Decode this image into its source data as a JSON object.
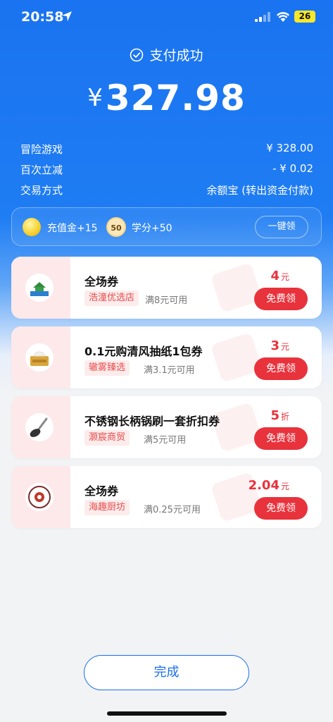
{
  "status_bar": {
    "time": "20:58",
    "battery": "26"
  },
  "header": {
    "status_text": "支付成功",
    "currency": "¥",
    "amount": "327.98"
  },
  "details": [
    {
      "label": "冒险游戏",
      "value": "¥ 328.00"
    },
    {
      "label": "百次立减",
      "value": "- ¥ 0.02"
    },
    {
      "label": "交易方式",
      "value": "余额宝 (转出资金付款)"
    }
  ],
  "rewards": {
    "item1": "充值金+15",
    "score_badge": "50",
    "item2": "学分+50",
    "claim_all": "一键领"
  },
  "coupons": [
    {
      "title": "全场券",
      "shop": "浩潼优选店",
      "condition": "满8元可用",
      "value": "4",
      "unit": "元",
      "button": "免费领",
      "logo_text": "浩潼优选"
    },
    {
      "title": "0.1元购清风抽纸1包券",
      "shop": "辙雾臻选",
      "condition": "满3.1元可用",
      "value": "3",
      "unit": "元",
      "button": "免费领"
    },
    {
      "title": "不锈钢长柄锅刷一套折扣券",
      "shop": "灏宸商贸",
      "condition": "满5元可用",
      "value": "5",
      "unit": "折",
      "button": "免费领"
    },
    {
      "title": "全场券",
      "shop": "海趣厨坊",
      "condition": "满0.25元可用",
      "value": "2.04",
      "unit": "元",
      "button": "免费领"
    }
  ],
  "footer": {
    "done": "完成"
  },
  "colors": {
    "primary_blue": "#1a73f0",
    "coupon_red": "#e8323c"
  }
}
